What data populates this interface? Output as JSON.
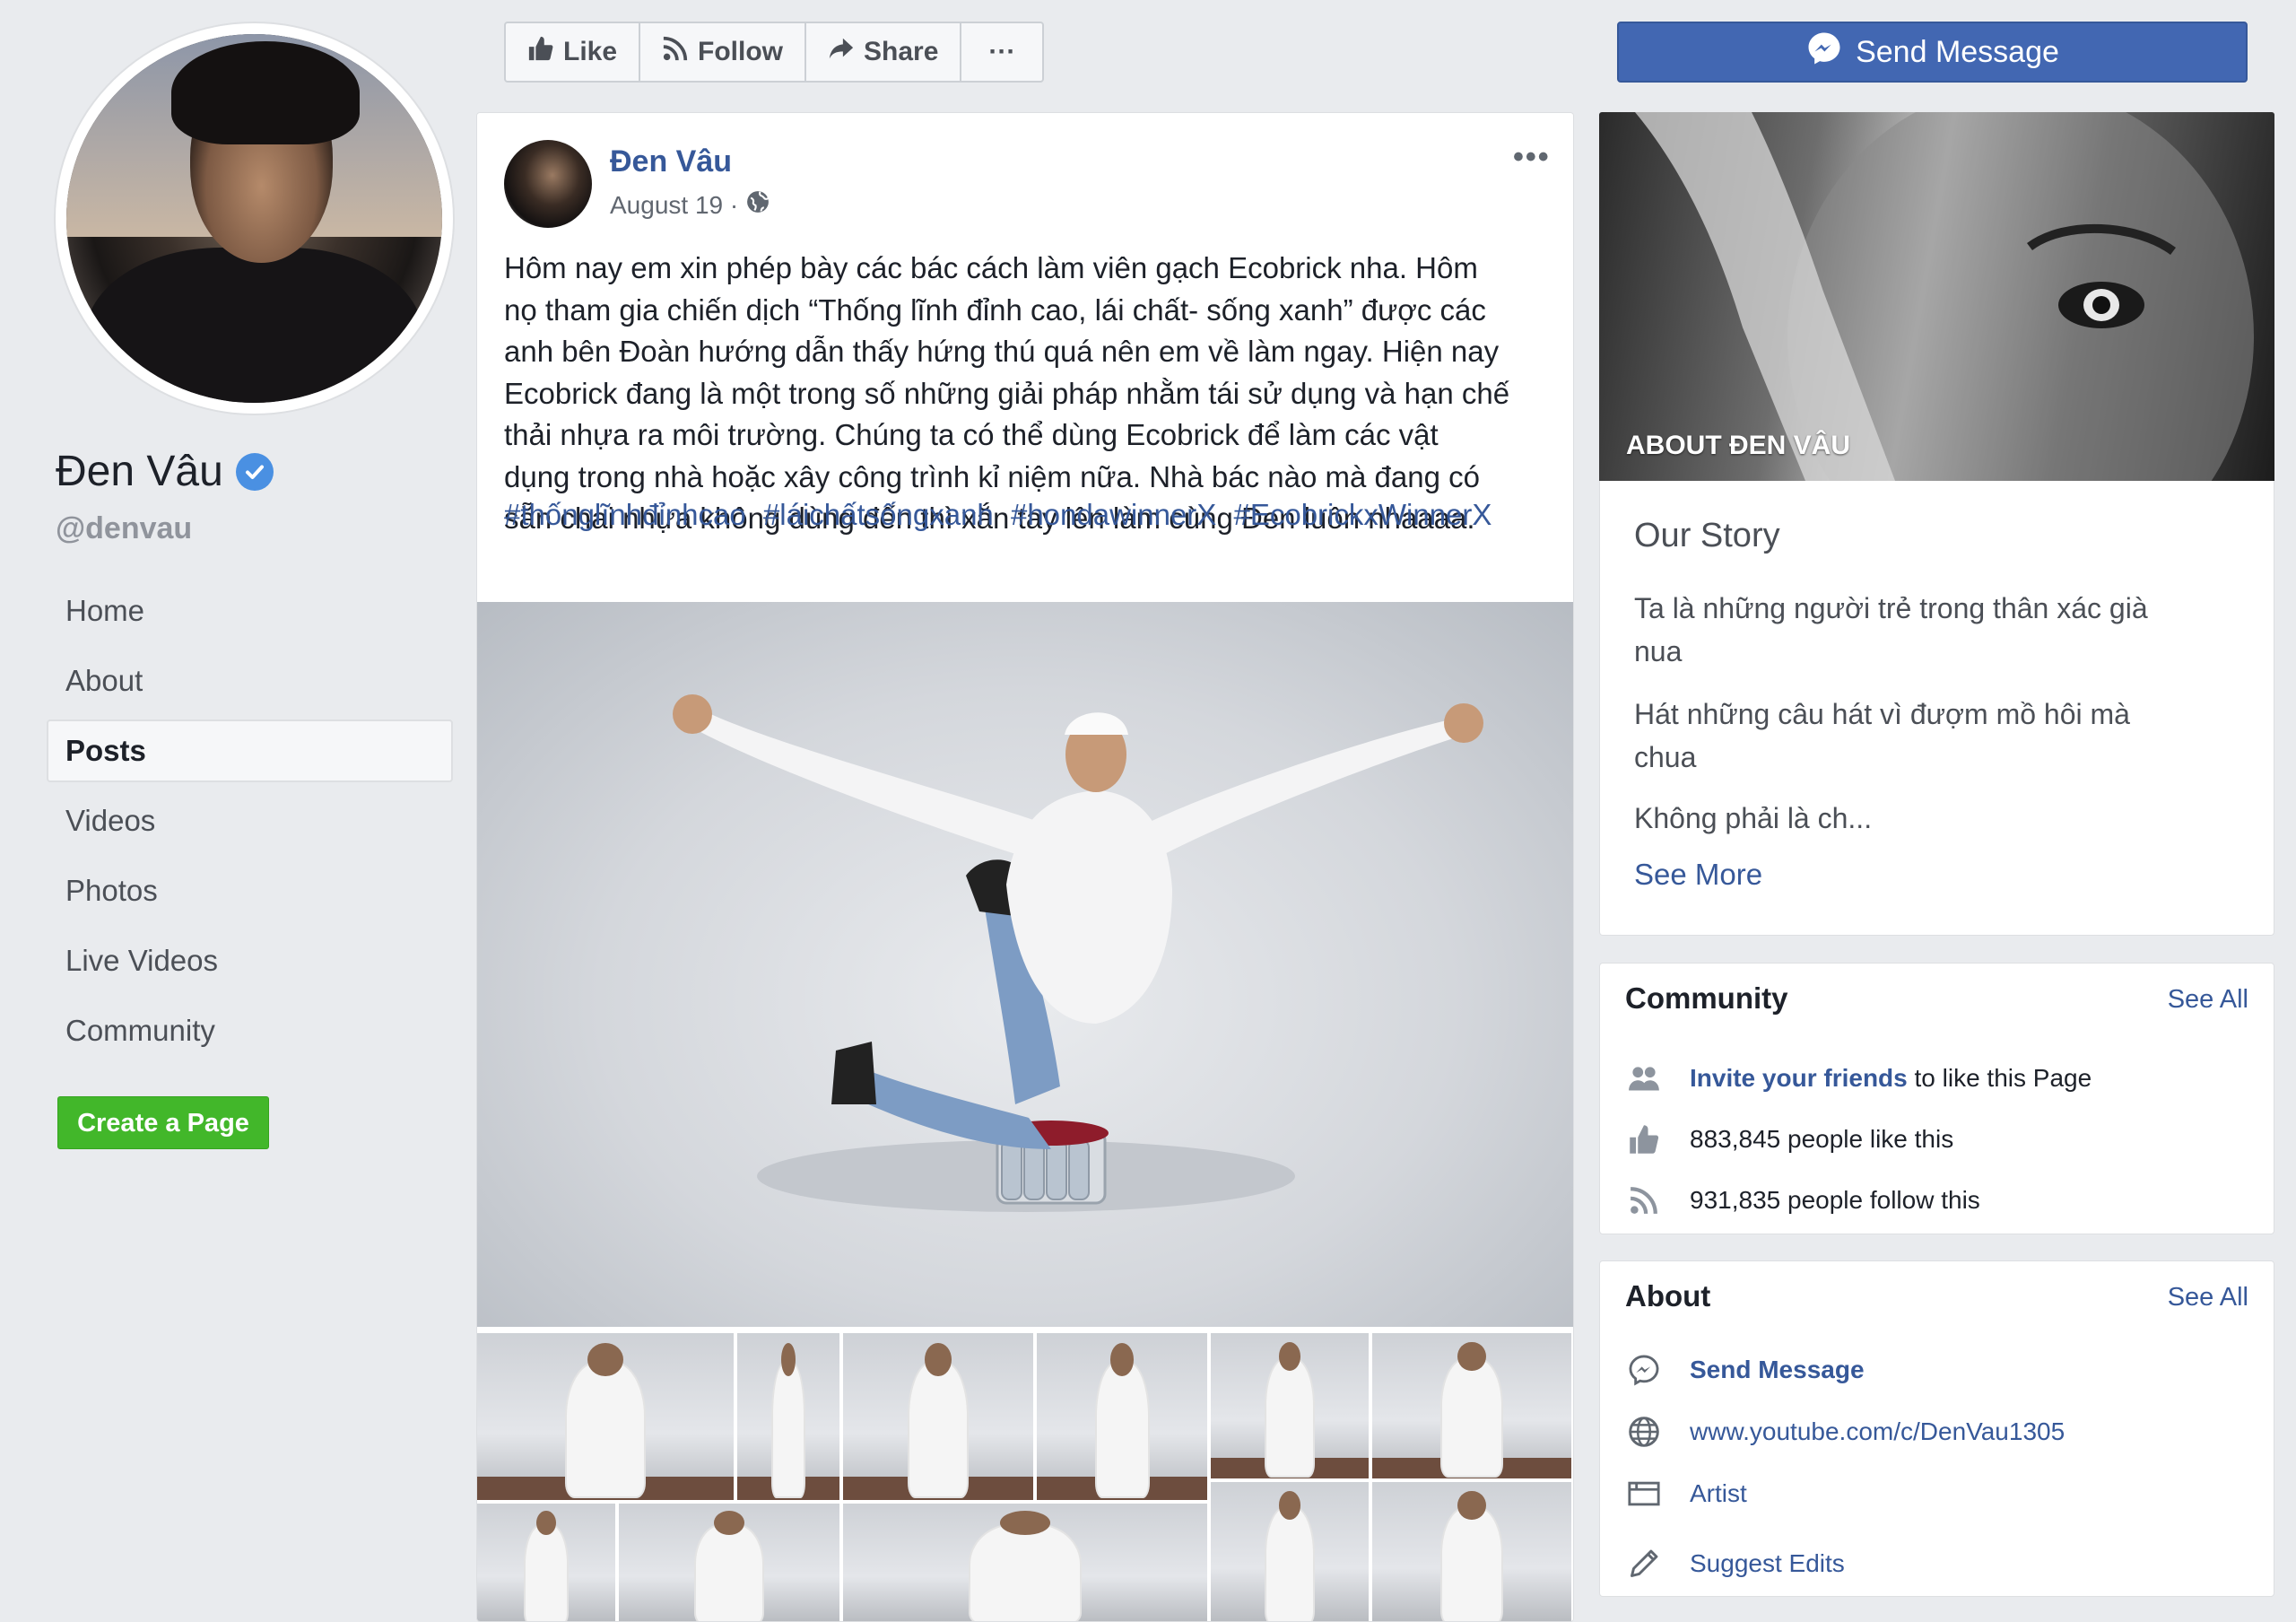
{
  "profile": {
    "name": "Đen Vâu",
    "handle": "@denvau"
  },
  "nav": {
    "items": [
      {
        "label": "Home"
      },
      {
        "label": "About"
      },
      {
        "label": "Posts",
        "active": true
      },
      {
        "label": "Videos"
      },
      {
        "label": "Photos"
      },
      {
        "label": "Live Videos"
      },
      {
        "label": "Community"
      }
    ],
    "create_page": "Create a Page"
  },
  "action_bar": {
    "like": "Like",
    "follow": "Follow",
    "share": "Share",
    "more": "···",
    "send_message": "Send Message"
  },
  "post": {
    "author": "Đen Vâu",
    "date": "August 19 ·",
    "menu": "•••",
    "text_lines": [
      "Hôm nay em xin phép bày các bác cách làm viên gạch Ecobrick nha. Hôm",
      "nọ tham gia chiến dịch “Thống lĩnh đỉnh cao, lái chất- sống xanh” được các",
      "anh bên Đoàn hướng dẫn thấy hứng thú quá nên em về làm ngay. Hiện nay",
      "Ecobrick đang là một trong số những giải pháp nhằm tái sử dụng và hạn chế",
      "thải nhựa ra môi trường. Chúng ta có thể dùng Ecobrick để làm các vật",
      "dụng trong nhà hoặc xây công trình kỉ niệm nữa. Nhà bác nào mà đang có",
      "sẵn chai nhựa không dùng đến thì xắn tay lên làm cùng Đen luôn nhaaaa."
    ],
    "hashtags": [
      "#thốnglĩnhđỉnhcao",
      "#láichấtsốngxanh",
      "#hondawinnerX",
      "#EcobrickxWinnerX"
    ]
  },
  "about_cover": {
    "caption": "ABOUT ĐEN VÂU"
  },
  "story": {
    "title": "Our Story",
    "lines": [
      "Ta là những người trẻ trong thân xác già",
      "nua",
      "Hát những câu hát vì đượm mồ hôi mà",
      "chua",
      "Không phải là ch..."
    ],
    "see_more": "See More"
  },
  "community": {
    "title": "Community",
    "see_all": "See All",
    "invite_link": "Invite your friends",
    "invite_rest": " to like this Page",
    "likes": "883,845 people like this",
    "follows": "931,835 people follow this"
  },
  "about": {
    "title": "About",
    "see_all": "See All",
    "send_message": "Send Message",
    "website": "www.youtube.com/c/DenVau1305",
    "category": "Artist",
    "suggest_edits": "Suggest Edits"
  },
  "colors": {
    "brand_blue": "#4267b2",
    "link_blue": "#365899",
    "create_green": "#42b72a",
    "verified_blue": "#4a90e2",
    "background": "#e9ebee"
  }
}
